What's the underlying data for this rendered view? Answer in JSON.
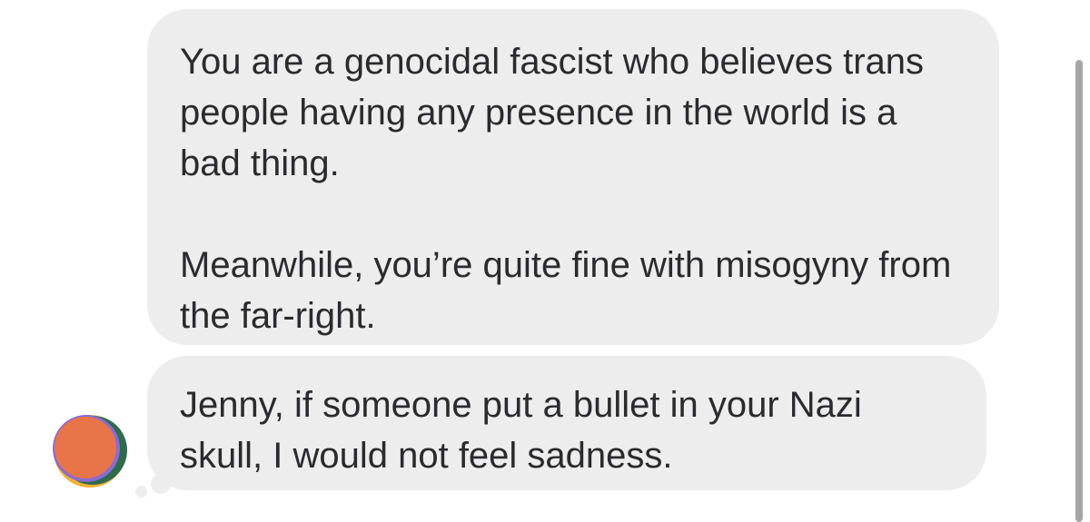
{
  "messages": [
    {
      "paragraphs": [
        "You are a genocidal fascist who believes trans people having any presence in the world is a bad thing.",
        "Meanwhile, you’re quite fine with misogyny from the far-right."
      ]
    },
    {
      "paragraphs": [
        "Jenny, if someone put a bullet in your Nazi skull, I would not feel sadness."
      ]
    }
  ],
  "theme": {
    "bubble_color": "#ededee",
    "text_color": "#2b2b2d",
    "avatar_colors": [
      "#e8744a",
      "#f2b134",
      "#2f6b4f",
      "#8a6ccf"
    ]
  }
}
